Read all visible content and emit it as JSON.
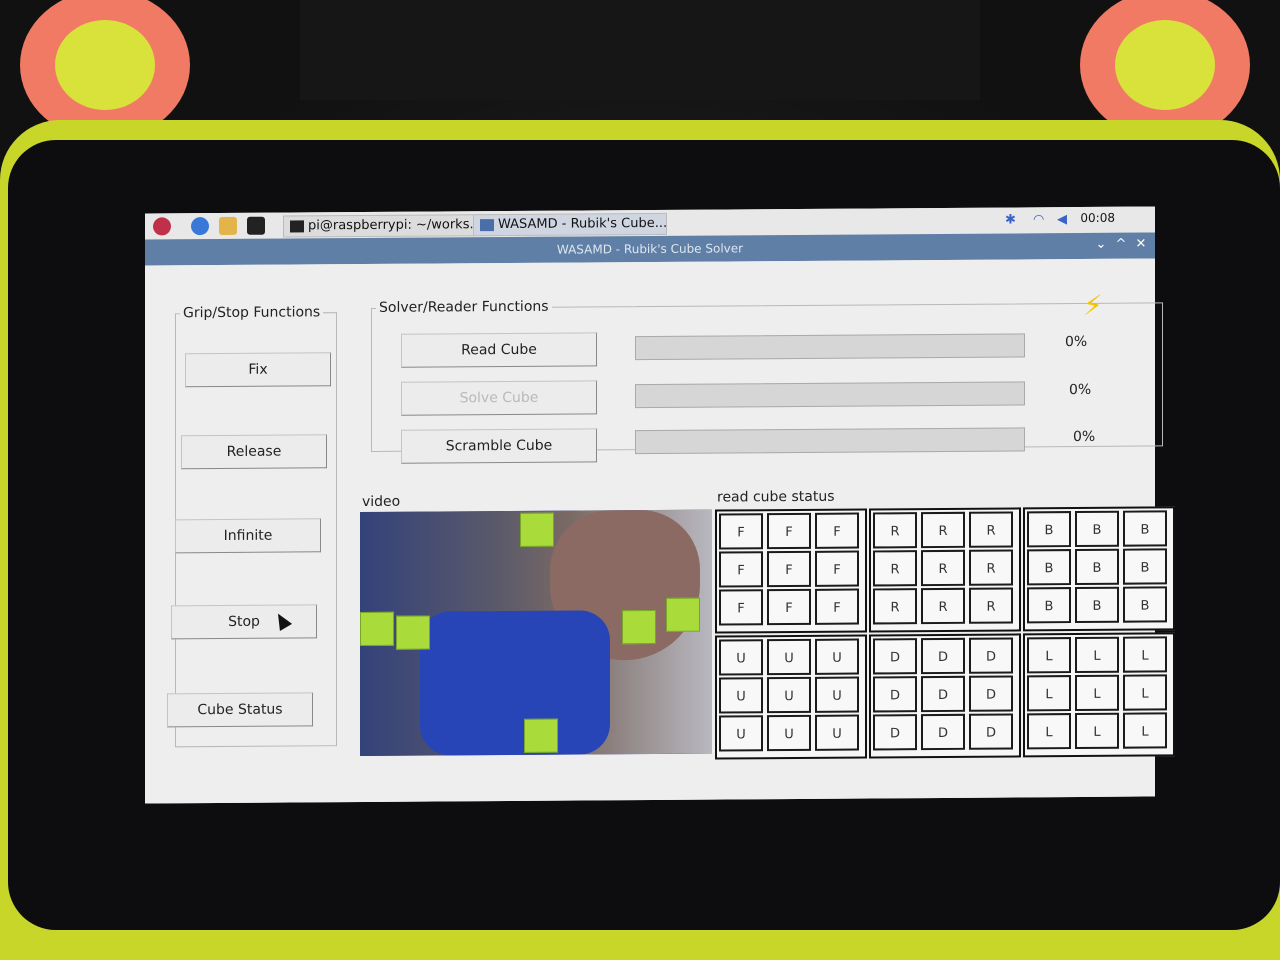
{
  "taskbar": {
    "task1": "pi@raspberrypi: ~/works...",
    "task2": "WASAMD - Rubik's Cube...",
    "clock": "00:08"
  },
  "window": {
    "title": "WASAMD - Rubik's Cube Solver"
  },
  "grip": {
    "legend": "Grip/Stop Functions",
    "buttons": [
      "Fix",
      "Release",
      "Infinite",
      "Stop",
      "Cube Status"
    ]
  },
  "solver": {
    "legend": "Solver/Reader Functions",
    "rows": [
      {
        "label": "Read Cube",
        "enabled": true,
        "progress": 0,
        "percent": "0%"
      },
      {
        "label": "Solve Cube",
        "enabled": false,
        "progress": 0,
        "percent": "0%"
      },
      {
        "label": "Scramble Cube",
        "enabled": true,
        "progress": 0,
        "percent": "0%"
      }
    ]
  },
  "video": {
    "legend": "video"
  },
  "cube_status": {
    "legend": "read cube status",
    "faces": [
      {
        "cells": [
          "F",
          "F",
          "F",
          "F",
          "F",
          "F",
          "F",
          "F",
          "F"
        ]
      },
      {
        "cells": [
          "R",
          "R",
          "R",
          "R",
          "R",
          "R",
          "R",
          "R",
          "R"
        ]
      },
      {
        "cells": [
          "B",
          "B",
          "B",
          "B",
          "B",
          "B",
          "B",
          "B",
          "B"
        ]
      },
      {
        "cells": [
          "U",
          "U",
          "U",
          "U",
          "U",
          "U",
          "U",
          "U",
          "U"
        ]
      },
      {
        "cells": [
          "D",
          "D",
          "D",
          "D",
          "D",
          "D",
          "D",
          "D",
          "D"
        ]
      },
      {
        "cells": [
          "L",
          "L",
          "L",
          "L",
          "L",
          "L",
          "L",
          "L",
          "L"
        ]
      }
    ]
  },
  "icons": {
    "raspberry": "raspberry-menu-icon",
    "globe": "browser-icon",
    "folder": "file-manager-icon",
    "terminal": "terminal-icon",
    "bluetooth": "bluetooth-icon",
    "wifi": "wifi-icon",
    "volume": "volume-icon",
    "lightning": "lightning-icon"
  },
  "colors": {
    "titlebar": "#5f7fa6",
    "lightning": "#f3c400",
    "tile_green": "#a9dc3a",
    "grid_accent": "#2fa6a0"
  }
}
